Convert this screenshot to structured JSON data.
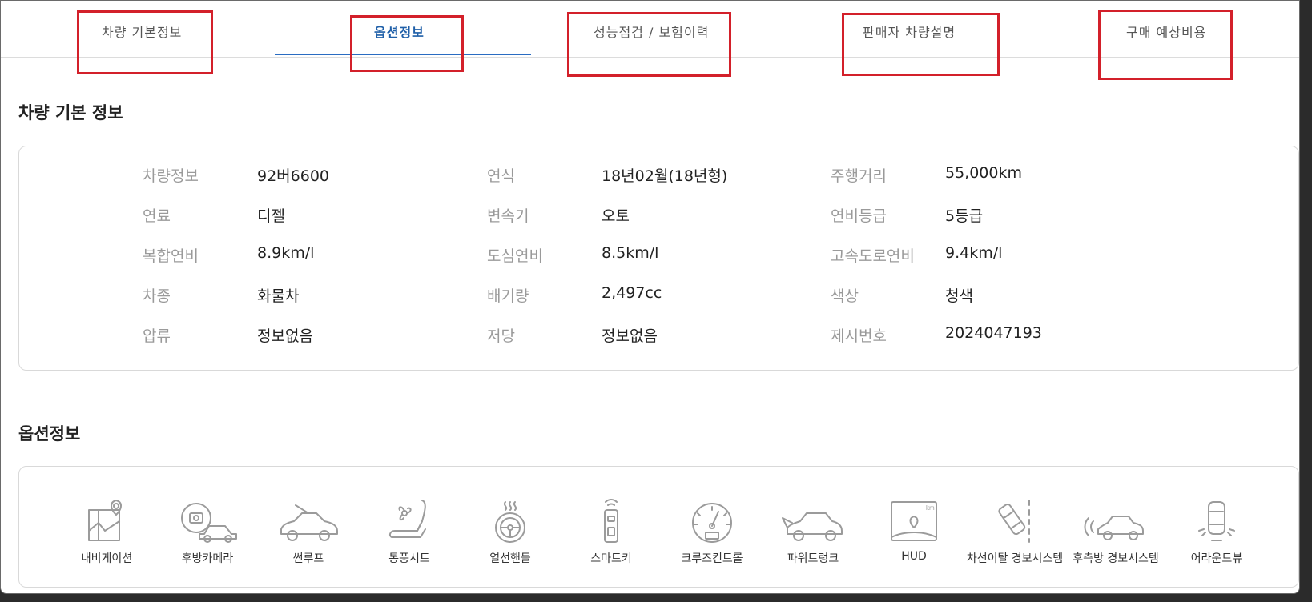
{
  "tabs": [
    {
      "label": "차량 기본정보"
    },
    {
      "label": "옵션정보"
    },
    {
      "label": "성능점검 / 보험이력"
    },
    {
      "label": "판매자 차량설명"
    },
    {
      "label": "구매 예상비용"
    }
  ],
  "basic_info": {
    "title": "차량 기본 정보",
    "rows": [
      [
        {
          "label": "차량정보",
          "value": "92버6600"
        },
        {
          "label": "연식",
          "value": "18년02월(18년형)"
        },
        {
          "label": "주행거리",
          "value": "55,000km"
        }
      ],
      [
        {
          "label": "연료",
          "value": "디젤"
        },
        {
          "label": "변속기",
          "value": "오토"
        },
        {
          "label": "연비등급",
          "value": "5등급"
        }
      ],
      [
        {
          "label": "복합연비",
          "value": "8.9km/l"
        },
        {
          "label": "도심연비",
          "value": "8.5km/l"
        },
        {
          "label": "고속도로연비",
          "value": "9.4km/l"
        }
      ],
      [
        {
          "label": "차종",
          "value": "화물차"
        },
        {
          "label": "배기량",
          "value": "2,497cc"
        },
        {
          "label": "색상",
          "value": "청색"
        }
      ],
      [
        {
          "label": "압류",
          "value": "정보없음"
        },
        {
          "label": "저당",
          "value": "정보없음"
        },
        {
          "label": "제시번호",
          "value": "2024047193"
        }
      ]
    ]
  },
  "options": {
    "title": "옵션정보",
    "items": [
      {
        "label": "내비게이션",
        "icon": "navigation-icon"
      },
      {
        "label": "후방카메라",
        "icon": "rear-camera-icon"
      },
      {
        "label": "썬루프",
        "icon": "sunroof-icon"
      },
      {
        "label": "통풍시트",
        "icon": "ventilated-seat-icon"
      },
      {
        "label": "열선핸들",
        "icon": "heated-steering-icon"
      },
      {
        "label": "스마트키",
        "icon": "smart-key-icon"
      },
      {
        "label": "크루즈컨트롤",
        "icon": "cruise-control-icon"
      },
      {
        "label": "파워트렁크",
        "icon": "power-trunk-icon"
      },
      {
        "label": "HUD",
        "icon": "hud-icon",
        "badge": "km"
      },
      {
        "label": "차선이탈 경보시스템",
        "icon": "lane-departure-icon"
      },
      {
        "label": "후측방 경보시스템",
        "icon": "blind-spot-icon"
      },
      {
        "label": "어라운드뷰",
        "icon": "around-view-icon"
      }
    ]
  },
  "colors": {
    "accent": "#2a6cc2",
    "highlight": "#d3202a"
  }
}
